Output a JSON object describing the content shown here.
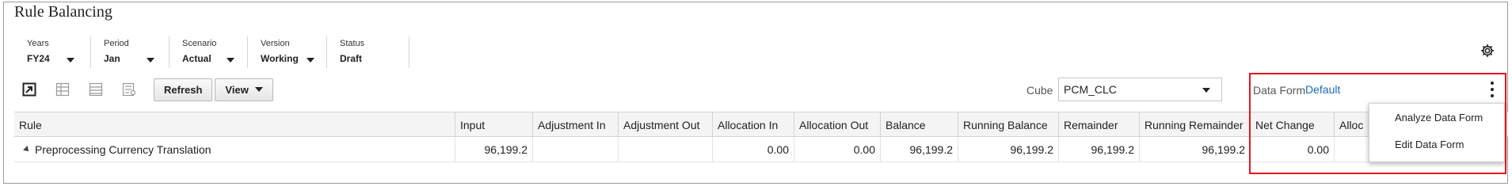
{
  "title": "Rule Balancing",
  "pov": [
    {
      "label": "Years",
      "value": "FY24"
    },
    {
      "label": "Period",
      "value": "Jan"
    },
    {
      "label": "Scenario",
      "value": "Actual"
    },
    {
      "label": "Version",
      "value": "Working"
    },
    {
      "label": "Status",
      "value": "Draft"
    }
  ],
  "toolbar": {
    "refresh_label": "Refresh",
    "view_label": "View",
    "icons": [
      "expand-icon",
      "columns-layout-icon",
      "list-layout-icon",
      "detail-layout-icon"
    ]
  },
  "cube": {
    "label": "Cube",
    "value": "PCM_CLC"
  },
  "data_form": {
    "label": "Data Form",
    "value": "Default"
  },
  "menu": {
    "items": [
      "Analyze Data Form",
      "Edit Data Form"
    ]
  },
  "grid": {
    "columns": [
      "Rule",
      "Input",
      "Adjustment In",
      "Adjustment Out",
      "Allocation In",
      "Allocation Out",
      "Balance",
      "Running Balance",
      "Remainder",
      "Running Remainder",
      "Net Change",
      "Alloc"
    ],
    "rows": [
      {
        "rule": "Preprocessing Currency Translation",
        "input": "96,199.2",
        "adj_in": "",
        "adj_out": "",
        "alloc_in": "0.00",
        "alloc_out": "0.00",
        "balance": "96,199.2",
        "running_balance": "96,199.2",
        "remainder": "96,199.2",
        "running_remainder": "96,199.2",
        "net_change": "0.00",
        "alloc": ""
      }
    ]
  },
  "colors": {
    "accent_link": "#1a6bb5",
    "highlight_border": "#e8141e"
  }
}
